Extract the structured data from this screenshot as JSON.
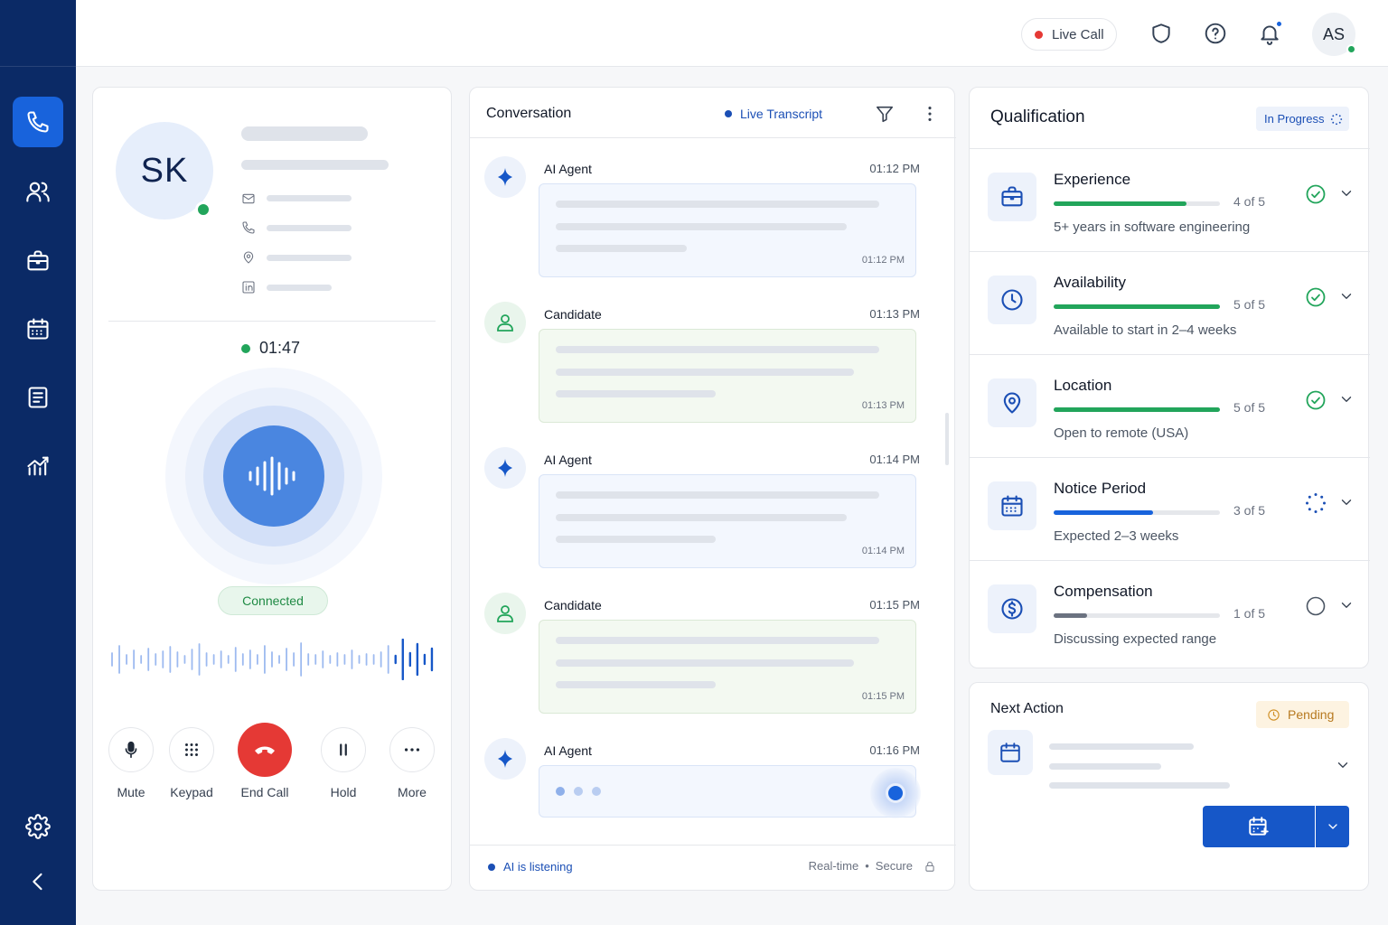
{
  "topbar": {
    "live_call_label": "Live Call",
    "user_initials": "AS"
  },
  "sidebar": {
    "items": [
      {
        "name": "calls",
        "icon": "phone-icon",
        "active": true
      },
      {
        "name": "candidates",
        "icon": "users-icon",
        "active": false
      },
      {
        "name": "jobs",
        "icon": "briefcase-icon",
        "active": false
      },
      {
        "name": "schedule",
        "icon": "calendar-icon",
        "active": false
      },
      {
        "name": "documents",
        "icon": "document-icon",
        "active": false
      },
      {
        "name": "analytics",
        "icon": "analytics-icon",
        "active": false
      }
    ],
    "bottom": [
      {
        "name": "settings",
        "icon": "gear-icon"
      },
      {
        "name": "collapse",
        "icon": "chevron-left-icon"
      }
    ]
  },
  "caller": {
    "initials": "SK",
    "timer": "01:47",
    "status": "Connected",
    "controls": [
      {
        "label": "Mute",
        "icon": "mic-icon"
      },
      {
        "label": "Keypad",
        "icon": "keypad-icon"
      },
      {
        "label": "End Call",
        "icon": "hangup-icon"
      },
      {
        "label": "Hold",
        "icon": "pause-icon"
      },
      {
        "label": "More",
        "icon": "more-icon"
      }
    ]
  },
  "conversation": {
    "title": "Conversation",
    "live_label": "Live Transcript",
    "messages": [
      {
        "sender": "AI Agent",
        "role": "ai",
        "time": "01:12 PM",
        "bubble_time": "01:12 PM"
      },
      {
        "sender": "Candidate",
        "role": "candidate",
        "time": "01:13 PM",
        "bubble_time": "01:13 PM"
      },
      {
        "sender": "AI Agent",
        "role": "ai",
        "time": "01:14 PM",
        "bubble_time": "01:14 PM"
      },
      {
        "sender": "Candidate",
        "role": "candidate",
        "time": "01:15 PM",
        "bubble_time": "01:15 PM"
      },
      {
        "sender": "AI Agent",
        "role": "ai",
        "time": "01:16 PM"
      }
    ],
    "footer_status": "AI is listening",
    "footer_realtime": "Real-time",
    "footer_secure": "Secure"
  },
  "qualification": {
    "title": "Qualification",
    "status": "In Progress",
    "items": [
      {
        "name": "Experience",
        "score": 4,
        "max": 5,
        "count": "4 of 5",
        "desc": "5+ years in software engineering",
        "state": "complete",
        "icon": "briefcase-icon",
        "color": "#22a55b"
      },
      {
        "name": "Availability",
        "score": 5,
        "max": 5,
        "count": "5 of 5",
        "desc": "Available to start in 2–4 weeks",
        "state": "complete",
        "icon": "clock-icon",
        "color": "#22a55b"
      },
      {
        "name": "Location",
        "score": 5,
        "max": 5,
        "count": "5 of 5",
        "desc": "Open to remote (USA)",
        "state": "complete",
        "icon": "location-icon",
        "color": "#22a55b"
      },
      {
        "name": "Notice Period",
        "score": 3,
        "max": 5,
        "count": "3 of 5",
        "desc": "Expected 2–3 weeks",
        "state": "in-progress",
        "icon": "calendar-icon",
        "color": "#1863dc"
      },
      {
        "name": "Compensation",
        "score": 1,
        "max": 5,
        "count": "1 of 5",
        "desc": "Discussing expected range",
        "state": "pending",
        "icon": "dollar-icon",
        "color": "#6b7280"
      }
    ]
  },
  "next_action": {
    "title": "Next Action",
    "status": "Pending"
  },
  "colors": {
    "sidebar": "#0b2a66",
    "accent": "#1863dc",
    "success": "#22a55b",
    "danger": "#e53935",
    "warning": "#d08f24"
  }
}
